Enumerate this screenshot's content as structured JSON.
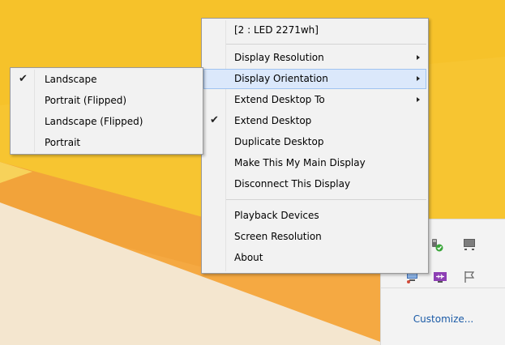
{
  "main_menu": {
    "header": "[2 : LED 2271wh]",
    "items": [
      {
        "label": "Display Resolution",
        "submenu": true
      },
      {
        "label": "Display Orientation",
        "submenu": true,
        "highlighted": true
      },
      {
        "label": "Extend Desktop To",
        "submenu": true
      },
      {
        "label": "Extend Desktop",
        "checked": true
      },
      {
        "label": "Duplicate Desktop"
      },
      {
        "label": "Make This My Main Display"
      },
      {
        "label": "Disconnect This Display"
      },
      {
        "label": "Playback Devices"
      },
      {
        "label": "Screen Resolution"
      },
      {
        "label": "About"
      }
    ]
  },
  "orientation_submenu": {
    "items": [
      {
        "label": "Landscape",
        "checked": true
      },
      {
        "label": "Portrait (Flipped)"
      },
      {
        "label": "Landscape (Flipped)"
      },
      {
        "label": "Portrait"
      }
    ]
  },
  "tray": {
    "icons": [
      "usb-device-check-icon",
      "monitor-icon",
      "display-network-icon",
      "usb-purple-icon",
      "action-center-flag-icon"
    ],
    "customize_label": "Customize..."
  },
  "colors": {
    "wallpaper_yellow": "#f7c531",
    "wallpaper_orange": "#f2a93b",
    "wallpaper_cream": "#f4e6cf",
    "menu_bg": "#f2f2f2",
    "highlight": "#dbe8fb",
    "link": "#1a5aa6"
  }
}
